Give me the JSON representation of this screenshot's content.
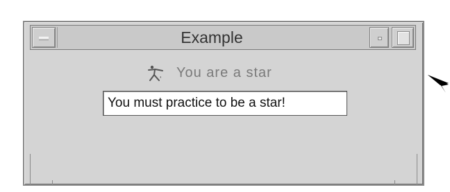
{
  "window": {
    "title": "Example"
  },
  "content": {
    "icon_label": {
      "text": "You are a star",
      "icon": "star-figure-icon"
    },
    "text_field": {
      "value": "You must practice to be a star!"
    }
  },
  "colors": {
    "window_bg": "#d4d4d4",
    "titlebar_bg": "#c9c9c9",
    "label_text": "#7a7a7a",
    "field_bg": "#ffffff"
  },
  "pointer": {
    "icon": "arrow-pointer-icon"
  }
}
